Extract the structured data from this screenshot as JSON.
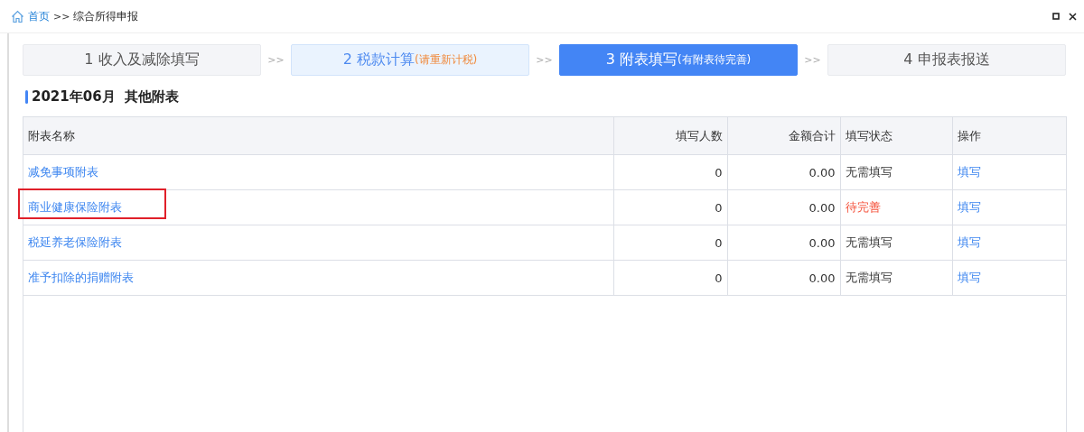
{
  "breadcrumb": {
    "home": "首页",
    "separator": ">>",
    "current": "综合所得申报"
  },
  "steps": [
    {
      "number": "1",
      "label": "收入及减除填写",
      "selected": false,
      "visited": false
    },
    {
      "number": "2",
      "label": "税款计算",
      "note": "(请重新计税)",
      "selected": false,
      "visited": true
    },
    {
      "number": "3",
      "label": "附表填写",
      "note": "(有附表待完善)",
      "selected": true
    },
    {
      "number": "4",
      "label": "申报表报送",
      "selected": false,
      "visited": false
    }
  ],
  "step_separators": [
    ">>",
    ">>",
    ">>"
  ],
  "section_title": "2021年06月  其他附表",
  "table": {
    "columns": [
      "附表名称",
      "填写人数",
      "金额合计",
      "填写状态",
      "操作"
    ],
    "rows": [
      {
        "name": "减免事项附表",
        "count": "0",
        "amount": "0.00",
        "status": "无需填写",
        "pending": false,
        "action": "填写",
        "highlighted": false
      },
      {
        "name": "商业健康保险附表",
        "count": "0",
        "amount": "0.00",
        "status": "待完善",
        "pending": true,
        "action": "填写",
        "highlighted": true
      },
      {
        "name": "税延养老保险附表",
        "count": "0",
        "amount": "0.00",
        "status": "无需填写",
        "pending": false,
        "action": "填写",
        "highlighted": false
      },
      {
        "name": "准予扣除的捐赠附表",
        "count": "0",
        "amount": "0.00",
        "status": "无需填写",
        "pending": false,
        "action": "填写",
        "highlighted": false
      }
    ]
  }
}
